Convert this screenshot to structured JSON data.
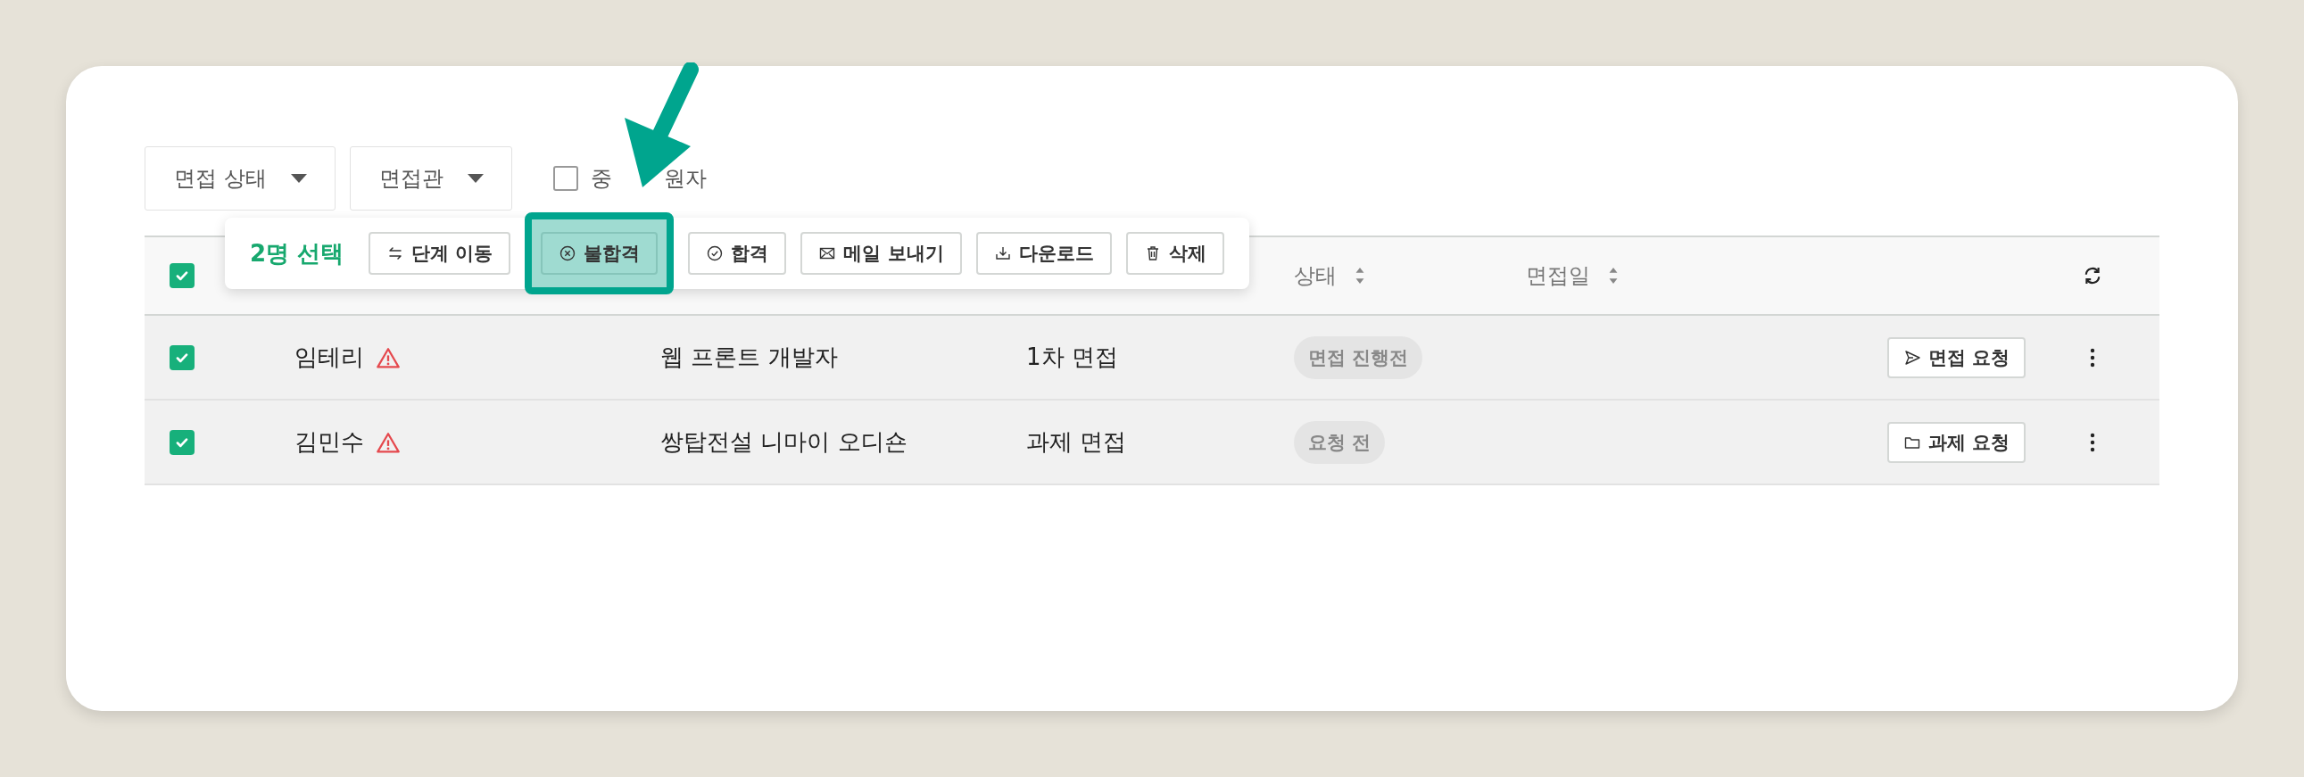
{
  "filters": [
    {
      "label": "면접 상태",
      "kind": "dropdown"
    },
    {
      "label": "면접관",
      "kind": "dropdown"
    }
  ],
  "duplicate_filter": {
    "label_parts": [
      "중",
      "원자"
    ],
    "checked": false
  },
  "selection_bar": {
    "count": "2명 선택",
    "actions": [
      {
        "label": "단계 이동",
        "highlighted": false
      },
      {
        "label": "불합격",
        "highlighted": true
      },
      {
        "label": "합격",
        "highlighted": false
      },
      {
        "label": "메일 보내기",
        "highlighted": false
      },
      {
        "label": "다운로드",
        "highlighted": false
      },
      {
        "label": "삭제",
        "highlighted": false
      }
    ]
  },
  "table": {
    "header_checked": true,
    "columns": [
      {
        "label": "상태",
        "sortable": true
      },
      {
        "label": "면접일",
        "sortable": true
      }
    ],
    "rows": [
      {
        "selected": true,
        "name": "임테리",
        "warning": true,
        "job": "웹 프론트 개발자",
        "stage": "1차 면접",
        "status": "면접 진행전",
        "action": {
          "label": "면접 요청"
        }
      },
      {
        "selected": true,
        "name": "김민수",
        "warning": true,
        "job": "쌍탑전설 니마이 오디숀",
        "stage": "과제 면접",
        "status": "요청 전",
        "action": {
          "label": "과제 요청"
        }
      }
    ]
  }
}
